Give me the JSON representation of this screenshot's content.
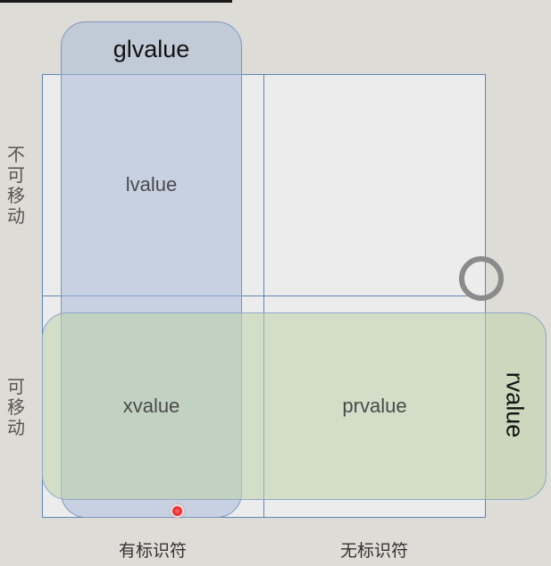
{
  "categories": {
    "glvalue": "glvalue",
    "rvalue": "rvalue",
    "lvalue": "lvalue",
    "xvalue": "xvalue",
    "prvalue": "prvalue"
  },
  "rows": {
    "not_movable": "不可移动",
    "movable": "可移动"
  },
  "columns": {
    "has_identity": "有标识符",
    "no_identity": "无标识符"
  },
  "overlays": {
    "loading_indicator": "loading-ring-icon",
    "cursor": "red-pointer-dot-icon"
  },
  "colors": {
    "background": "#dedcd6",
    "grid_line": "#5b86b8",
    "glvalue_fill": "#aabcd8",
    "rvalue_fill": "#bed4aa"
  }
}
